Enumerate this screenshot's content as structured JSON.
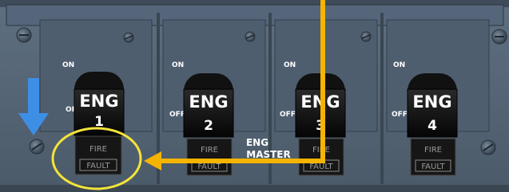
{
  "panel": {
    "on_label": "ON",
    "off_label": "OFF",
    "master_line1": "ENG",
    "master_line2": "MASTER"
  },
  "switches": [
    {
      "top": "ENG",
      "num": "1",
      "fire": "FIRE",
      "fault": "FAULT"
    },
    {
      "top": "ENG",
      "num": "2",
      "fire": "FIRE",
      "fault": "FAULT"
    },
    {
      "top": "ENG",
      "num": "3",
      "fire": "FIRE",
      "fault": "FAULT"
    },
    {
      "top": "ENG",
      "num": "4",
      "fire": "FIRE",
      "fault": "FAULT"
    }
  ],
  "annotations": {
    "arrow_color": "#3d8fe6",
    "highlight_color": "#f4e33a",
    "pointer_color": "#f5b400"
  },
  "colors": {
    "panel": "#536474",
    "panel_dark": "#2a3440",
    "knob": "#0a0a0a"
  }
}
